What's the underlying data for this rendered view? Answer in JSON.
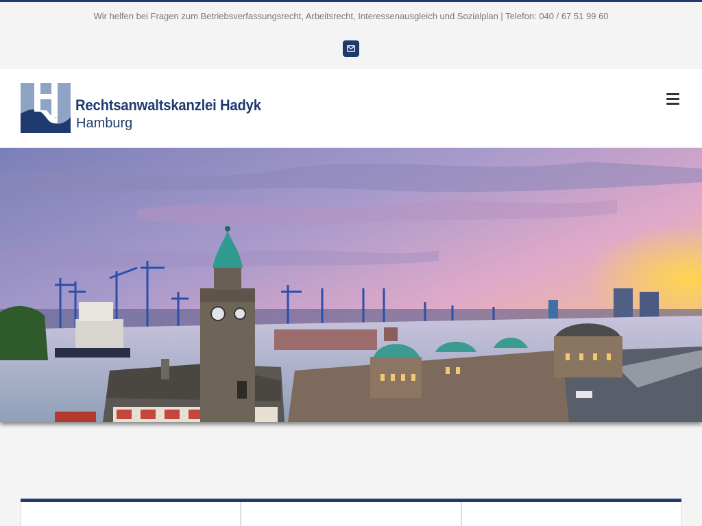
{
  "topbar": {
    "info_text": "Wir helfen bei Fragen zum Betriebsverfassungsrecht, Arbeitsrecht, Interessenausgleich und Sozialplan | Telefon: 040 / 67 51 99 60",
    "mail_icon": "envelope-icon"
  },
  "header": {
    "brand_name": "Rechtsanwaltskanzlei Hadyk",
    "brand_city": "Hamburg",
    "menu_icon": "hamburger-menu-icon"
  },
  "colors": {
    "brand": "#1f3a6e",
    "topbar_bg": "#f4f4f4",
    "header_bg": "#ffffff"
  },
  "hero": {
    "image_subject": "Hamburg harbour panorama at sunset with St. Pauli Landungsbrücken clock tower and container cranes"
  },
  "cards": {
    "count": 3
  }
}
